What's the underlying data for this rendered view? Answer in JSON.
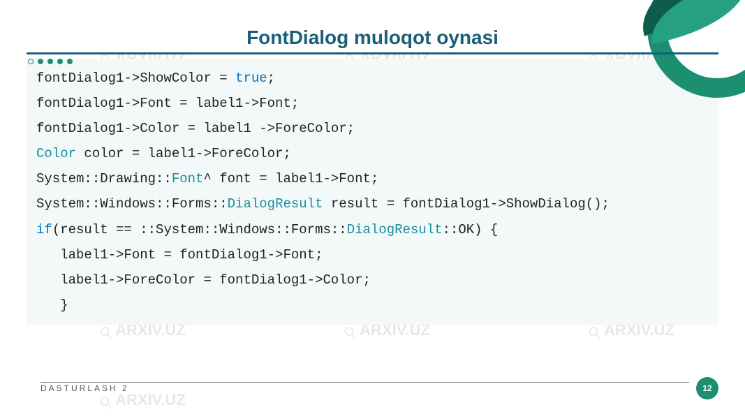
{
  "watermark_text": "ARXIV.UZ",
  "title": "FontDialog muloqot oynasi",
  "code": {
    "l1a": "fontDialog1->ShowColor = ",
    "l1b_kw": "true",
    "l1c": ";",
    "l2": "fontDialog1->Font = label1->Font;",
    "l3": "fontDialog1->Color = label1 ->ForeColor;",
    "l4a_kw": "Color",
    "l4b": " color = label1->ForeColor;",
    "l5a": "System::Drawing::",
    "l5b_kw": "Font",
    "l5c": "^ font = label1->Font;",
    "l6a": "System::Windows::Forms::",
    "l6b_kw": "DialogResult",
    "l6c": " result = fontDialog1->ShowDialog();",
    "l7a_kw": "if",
    "l7b": "(result == ::System::Windows::Forms::",
    "l7c_kw": "DialogResult",
    "l7d": "::OK) {",
    "l8": "   label1->Font = fontDialog1->Font;",
    "l9": "   label1->ForeColor = fontDialog1->Color;",
    "l10": "   }"
  },
  "footer_text": "DASTURLASH 2",
  "page_number": "12"
}
